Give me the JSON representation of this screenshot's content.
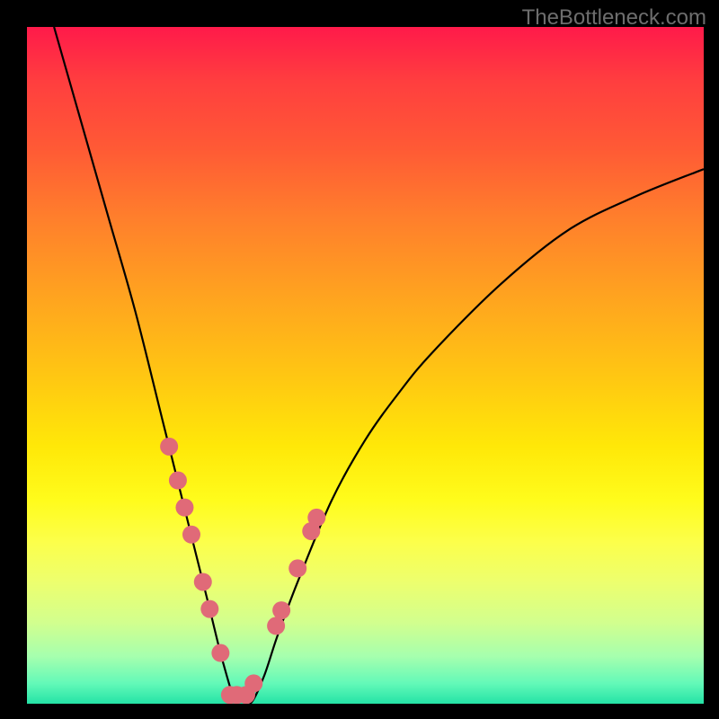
{
  "watermark": "TheBottleneck.com",
  "chart_data": {
    "type": "line",
    "title": "",
    "xlabel": "",
    "ylabel": "",
    "xlim": [
      0,
      100
    ],
    "ylim": [
      0,
      100
    ],
    "background_gradient": {
      "top": "#ff1a4a",
      "mid": "#ffe808",
      "bottom": "#24e3a6"
    },
    "curve": {
      "x": [
        4,
        8,
        12,
        16,
        20,
        23,
        25,
        27,
        29,
        31,
        33,
        35,
        37,
        40,
        45,
        50,
        55,
        60,
        70,
        80,
        90,
        100
      ],
      "y": [
        100,
        86,
        72,
        58,
        42,
        30,
        22,
        14,
        6,
        0,
        0,
        4,
        10,
        18,
        30,
        39,
        46,
        52,
        62,
        70,
        75,
        79
      ]
    },
    "markers": {
      "type": "scatter",
      "color": "#e06a78",
      "radius": 10,
      "x": [
        21.0,
        22.3,
        23.3,
        24.3,
        26.0,
        27.0,
        28.6,
        30.0,
        31.0,
        32.4,
        33.5,
        36.8,
        37.6,
        40.0,
        42.0,
        42.8
      ],
      "y": [
        38.0,
        33.0,
        29.0,
        25.0,
        18.0,
        14.0,
        7.5,
        1.3,
        1.3,
        1.3,
        3.0,
        11.5,
        13.8,
        20.0,
        25.5,
        27.5
      ]
    }
  }
}
